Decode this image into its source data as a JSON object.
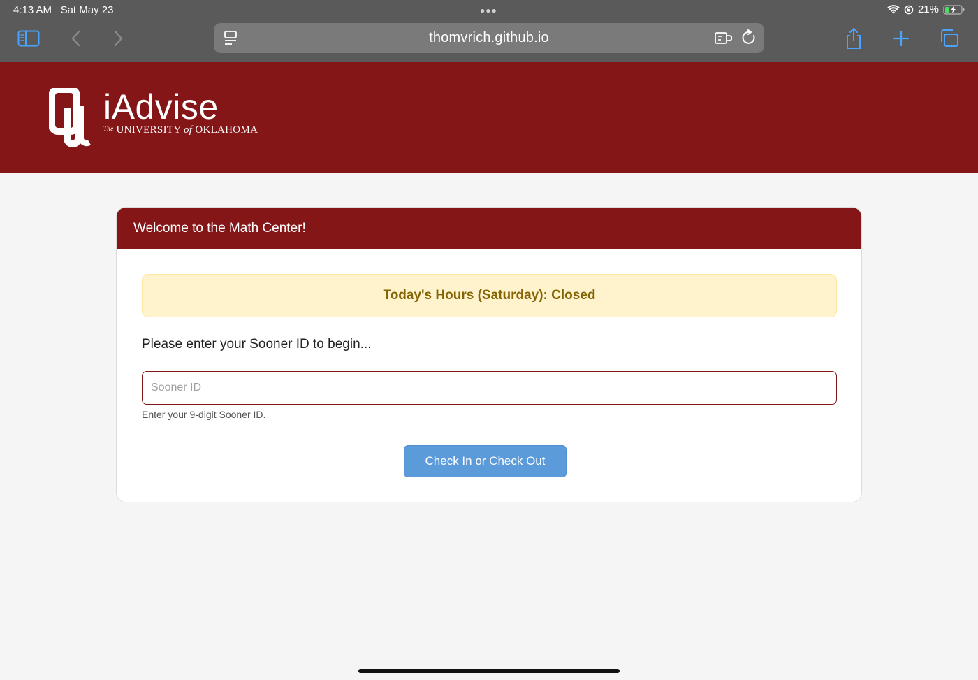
{
  "status_bar": {
    "time": "4:13 AM",
    "date": "Sat May 23",
    "battery": "21%"
  },
  "browser": {
    "url": "thomvrich.github.io"
  },
  "header": {
    "brand_name": "iAdvise",
    "brand_sub_the": "The",
    "brand_sub_university": "UNIVERSITY",
    "brand_sub_of": "of",
    "brand_sub_state": "OKLAHOMA",
    "accent_color": "#841617"
  },
  "card": {
    "title": "Welcome to the Math Center!",
    "hours_text": "Today's Hours (Saturday): Closed",
    "prompt": "Please enter your Sooner ID to begin...",
    "input_placeholder": "Sooner ID",
    "input_value": "",
    "help_text": "Enter your 9-digit Sooner ID.",
    "button_label": "Check In or Check Out",
    "button_color": "#5b9bd9"
  }
}
